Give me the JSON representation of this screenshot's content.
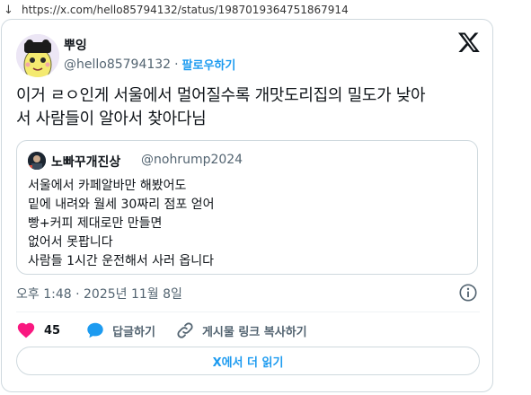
{
  "browser": {
    "url": "https://x.com/hello85794132/status/1987019364751867914",
    "nav_arrow": "↓"
  },
  "tweet": {
    "author_name": "뿌잉",
    "author_handle": "@hello85794132",
    "separator": "·",
    "follow_label": "팔로우하기",
    "text": "이거 ㄹㅇ인게 서울에서 멀어질수록 개맛도리집의 밀도가 낮아\n서 사람들이 알아서 찾아다님",
    "timestamp": "오후 1:48 · 2025년 11월 8일",
    "like_count": "45",
    "reply_label": "답글하기",
    "copy_link_label": "게시물 링크 복사하기",
    "read_more_label": "X에서 더 읽기"
  },
  "quote": {
    "author_name": "노빠꾸개진상",
    "author_handle": "@nohrump2024",
    "lines": [
      "서울에서 카페알바만 해봤어도",
      "밑에 내려와 월세 30짜리 점포 얻어",
      "빵+커피 제대로만 만들면",
      "없어서 못팝니다",
      "사람들 1시간 운전해서 사러 옵니다"
    ]
  },
  "colors": {
    "accent": "#1d9bf0",
    "like": "#f91880",
    "secondary_text": "#536471",
    "border": "#cfd9de"
  },
  "icons": {
    "brand": "x-logo-icon",
    "info": "info-icon",
    "like": "heart-icon",
    "reply": "speech-bubble-icon",
    "copy_link": "link-icon"
  }
}
